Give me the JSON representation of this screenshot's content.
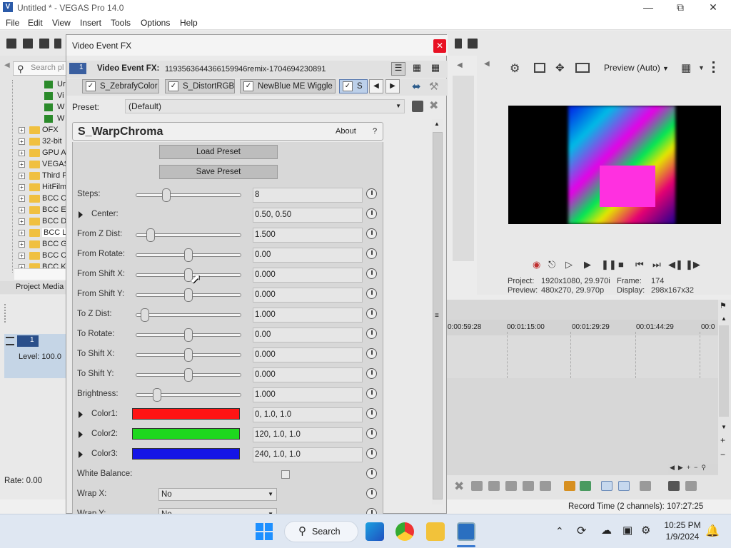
{
  "window": {
    "title": "Untitled * - VEGAS Pro 14.0",
    "icon": "vegas-app-icon",
    "controls": [
      "minimize-icon",
      "maximize-icon",
      "close-icon"
    ]
  },
  "menu": [
    "File",
    "Edit",
    "View",
    "Insert",
    "Tools",
    "Options",
    "Help"
  ],
  "explorer": {
    "search_placeholder": "Search pl",
    "tree": [
      "Ur",
      "Vi",
      "W",
      "W",
      "OFX",
      "32-bit",
      "GPU A",
      "VEGAS",
      "Third F",
      "HitFilm",
      "BCC C",
      "BCC E",
      "BCC D",
      "BCC Li",
      "BCC G",
      "BCC C",
      "BCC K"
    ],
    "tab_label": "Project Media"
  },
  "track": {
    "number": "1",
    "level": "Level: 100.0 "
  },
  "rate": "Rate: 0.00",
  "dialog": {
    "title": "Video Event FX",
    "fx_badge": "1",
    "fx_label": "Video Event FX:",
    "fx_id": "1193563644366159946remix-1704694230891",
    "chain": [
      "S_ZebrafyColor",
      "S_DistortRGB",
      "NewBlue ME Wiggle",
      "S"
    ],
    "preset_label": "Preset:",
    "preset_value": "(Default)",
    "plugin_name": "S_WarpChroma",
    "about": "About",
    "help": "?",
    "load_preset": "Load Preset",
    "save_preset": "Save Preset",
    "params": [
      {
        "label": "Steps:",
        "type": "slider",
        "slider_pos": 0.29,
        "value": "8"
      },
      {
        "label": "Center:",
        "type": "expand",
        "value": "0.50, 0.50"
      },
      {
        "label": "From Z Dist:",
        "type": "slider",
        "slider_pos": 0.14,
        "value": "1.500"
      },
      {
        "label": "From Rotate:",
        "type": "slider",
        "slider_pos": 0.5,
        "value": "0.00"
      },
      {
        "label": "From Shift X:",
        "type": "slider",
        "slider_pos": 0.5,
        "value": "0.000"
      },
      {
        "label": "From Shift Y:",
        "type": "slider",
        "slider_pos": 0.5,
        "value": "0.000"
      },
      {
        "label": "To Z Dist:",
        "type": "slider",
        "slider_pos": 0.09,
        "value": "1.000"
      },
      {
        "label": "To Rotate:",
        "type": "slider",
        "slider_pos": 0.5,
        "value": "0.00"
      },
      {
        "label": "To Shift X:",
        "type": "slider",
        "slider_pos": 0.5,
        "value": "0.000"
      },
      {
        "label": "To Shift Y:",
        "type": "slider",
        "slider_pos": 0.5,
        "value": "0.000"
      },
      {
        "label": "Brightness:",
        "type": "slider",
        "slider_pos": 0.2,
        "value": "1.000"
      },
      {
        "label": "Color1:",
        "type": "color",
        "color": "#ff1414",
        "value": "0, 1.0, 1.0"
      },
      {
        "label": "Color2:",
        "type": "color",
        "color": "#1ed81e",
        "value": "120, 1.0, 1.0"
      },
      {
        "label": "Color3:",
        "type": "color",
        "color": "#1414e6",
        "value": "240, 1.0, 1.0"
      },
      {
        "label": "White Balance:",
        "type": "checkbox",
        "checked": false
      },
      {
        "label": "Wrap X:",
        "type": "dropdown",
        "value": "No"
      },
      {
        "label": "Wrap Y:",
        "type": "dropdown",
        "value": "No"
      }
    ]
  },
  "preview": {
    "quality": "Preview (Auto)",
    "project_label": "Project:",
    "project_value": "1920x1080, 29.970i",
    "preview_label": "Preview:",
    "preview_value": "480x270, 29.970p",
    "frame_label": "Frame:",
    "frame_value": "174",
    "display_label": "Display:",
    "display_value": "298x167x32"
  },
  "timeline": {
    "ruler": [
      "0:00:59:28",
      "00:01:15:00",
      "00:01:29:29",
      "00:01:44:29",
      "00:0"
    ]
  },
  "status": {
    "record_time": "Record Time (2 channels): 107:27:25"
  },
  "taskbar": {
    "search_label": "Search",
    "time": "10:25 PM",
    "date": "1/9/2024"
  }
}
